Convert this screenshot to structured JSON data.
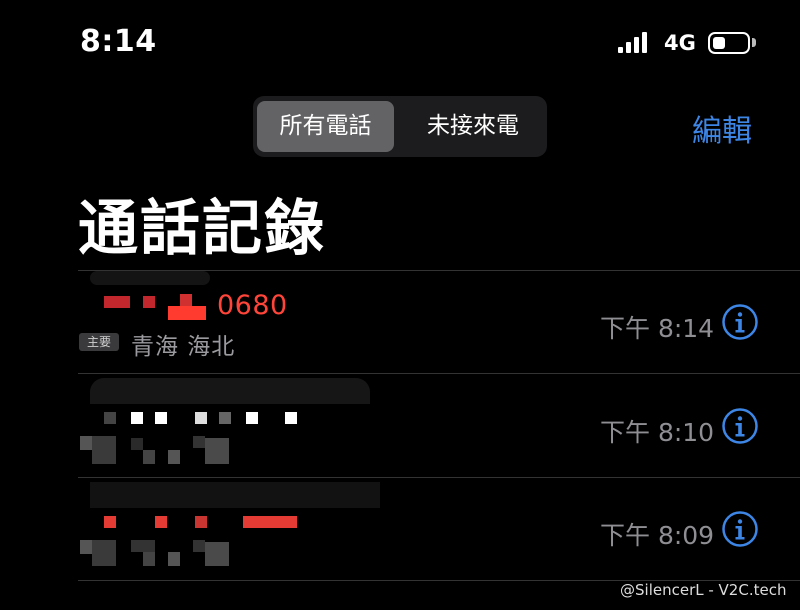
{
  "status_bar": {
    "time": "8:14",
    "network": "4G"
  },
  "segmented_control": {
    "all_calls": "所有電話",
    "missed_calls": "未接來電"
  },
  "edit_label": "編輯",
  "title": "通話記錄",
  "calls": [
    {
      "number_visible_part": "0680",
      "tag": "主要",
      "location": "青海 海北",
      "time": "下午 8:14",
      "missed": true
    },
    {
      "time": "下午 8:10",
      "missed": false
    },
    {
      "time": "下午 8:09",
      "missed": true
    }
  ],
  "watermark": "@SilencerL - V2C.tech",
  "colors": {
    "accent": "#3d86e6",
    "missed": "#ff453a",
    "secondary": "#8e8e93"
  },
  "icons": [
    "signal-icon",
    "battery-icon",
    "info-icon"
  ]
}
